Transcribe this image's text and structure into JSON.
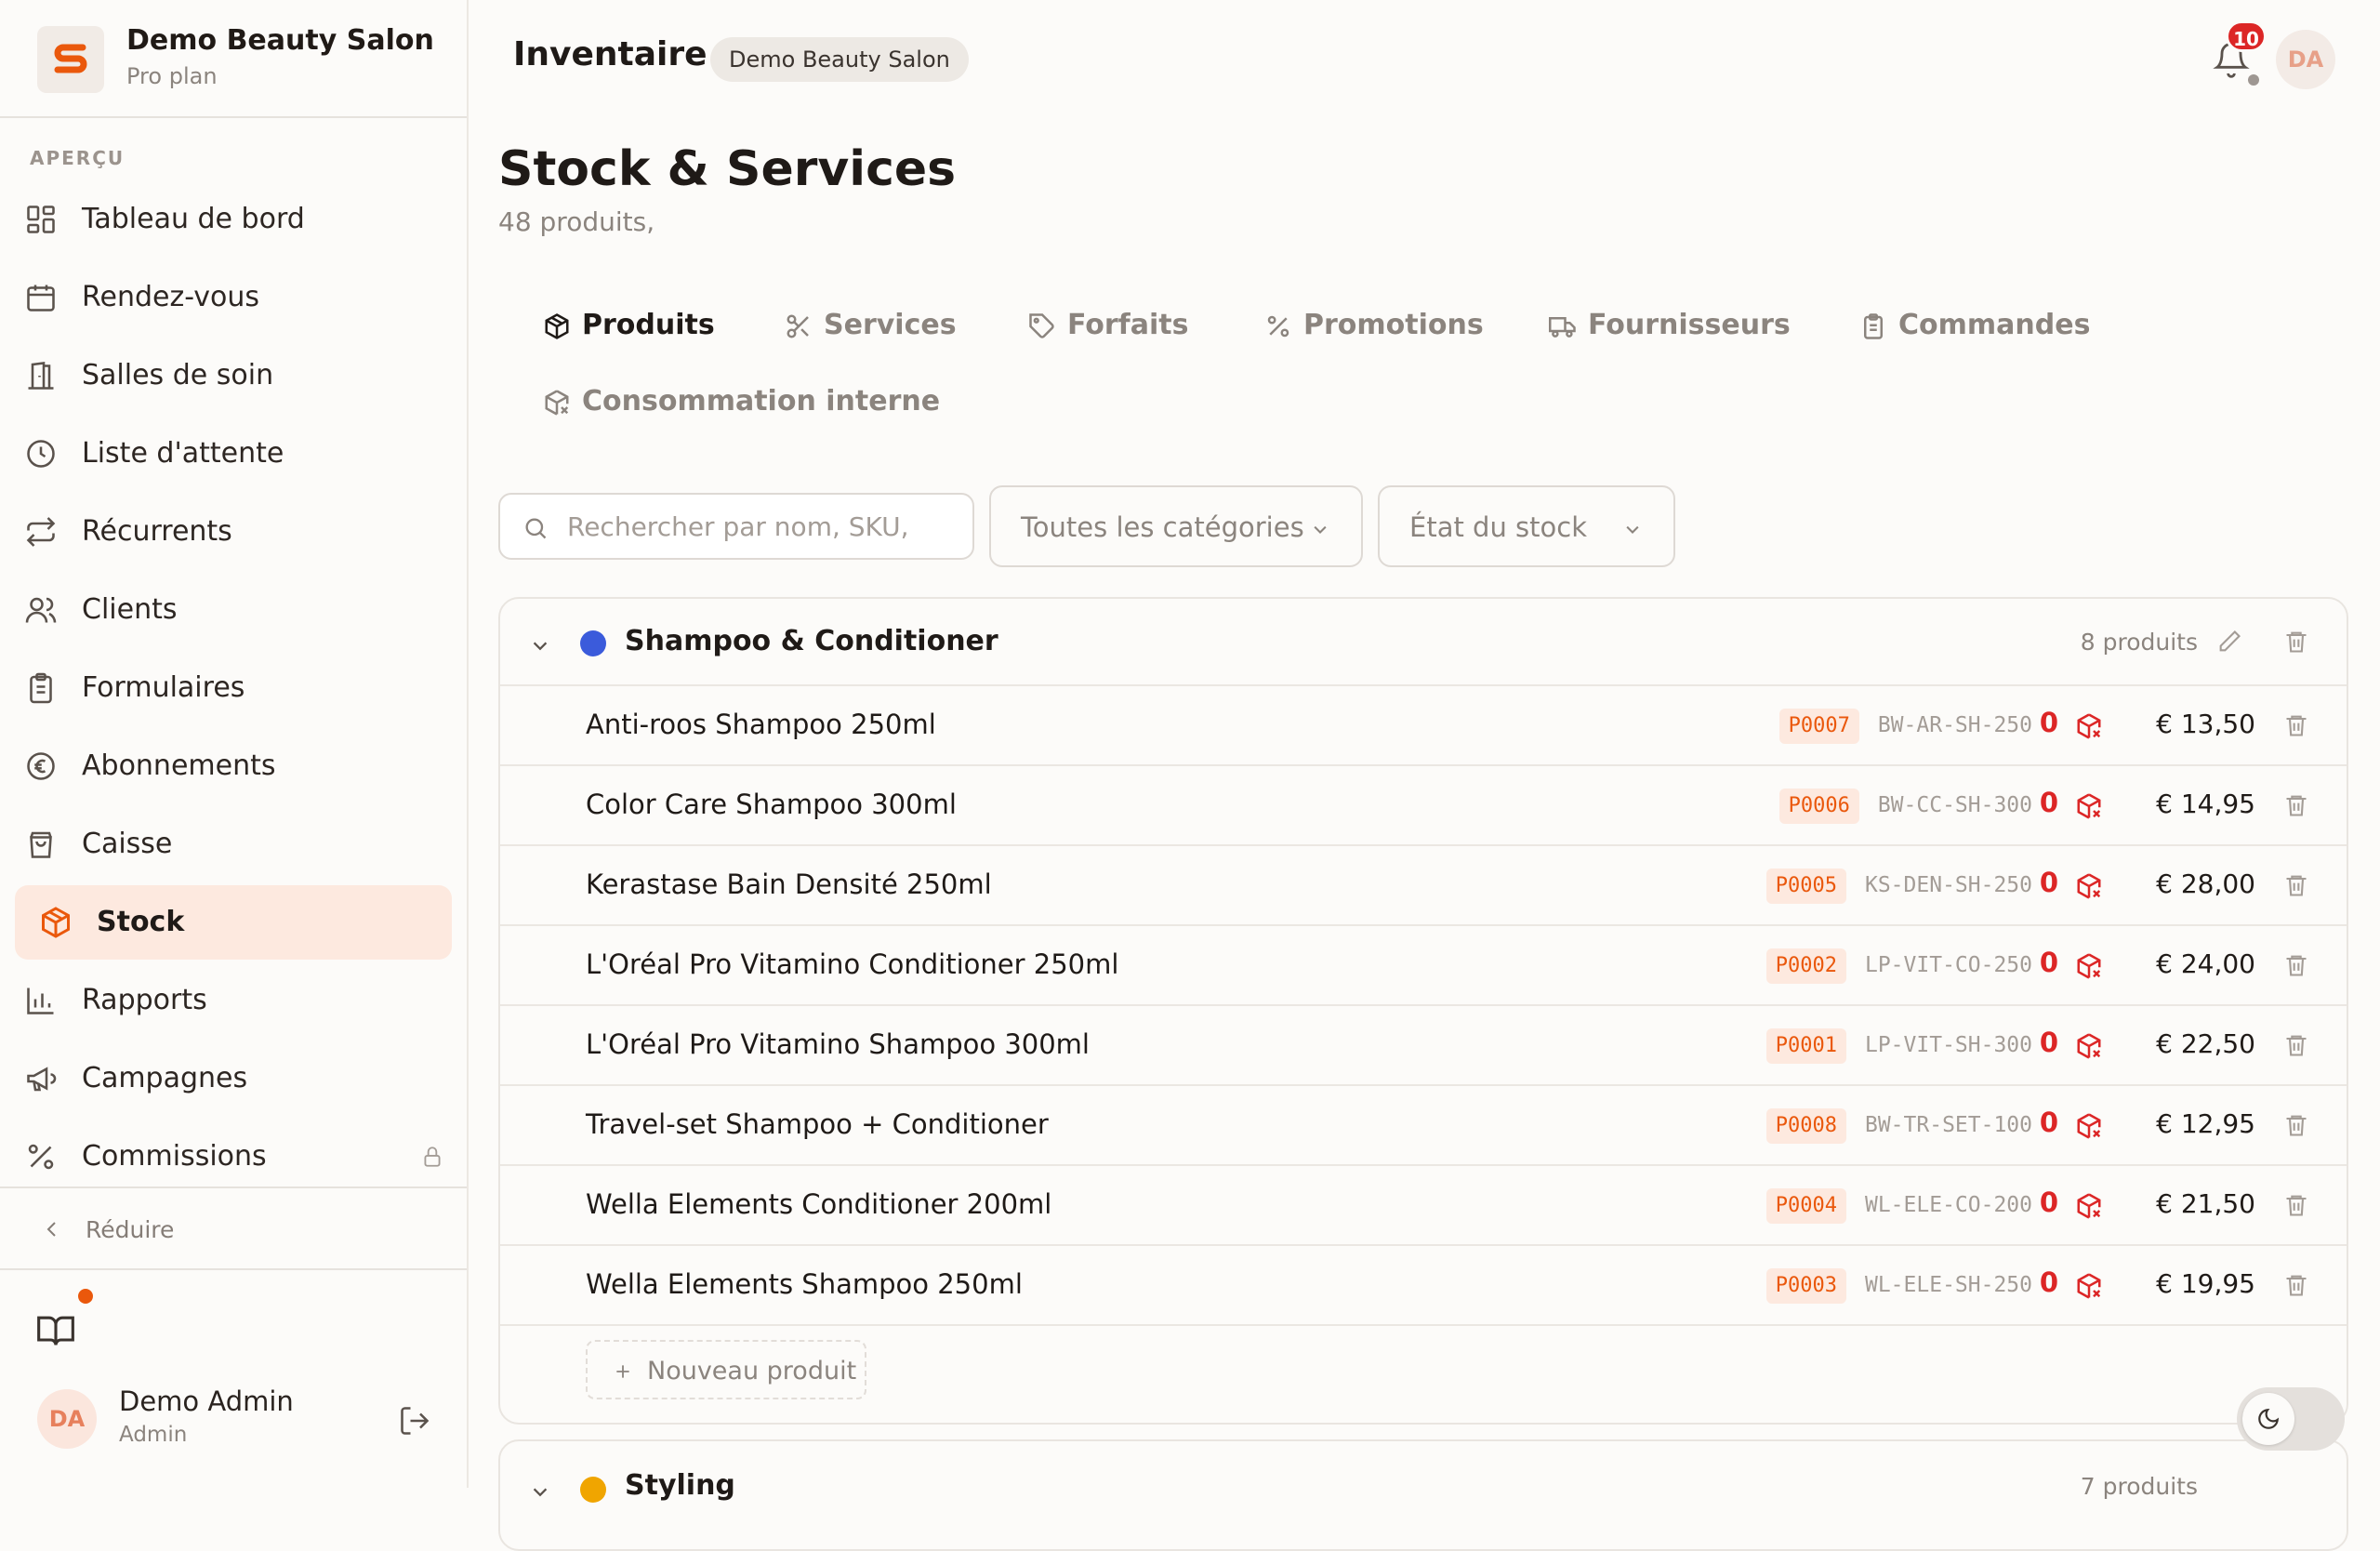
{
  "brand": {
    "name": "Demo Beauty Salon",
    "plan": "Pro plan",
    "logo_letter": "S",
    "accent": "#ea580c"
  },
  "sidebar": {
    "section": "APERÇU",
    "items": [
      {
        "label": "Tableau de bord",
        "icon": "grid-icon"
      },
      {
        "label": "Rendez-vous",
        "icon": "calendar-icon"
      },
      {
        "label": "Salles de soin",
        "icon": "door-icon"
      },
      {
        "label": "Liste d'attente",
        "icon": "clock-icon"
      },
      {
        "label": "Récurrents",
        "icon": "repeat-icon"
      },
      {
        "label": "Clients",
        "icon": "users-icon"
      },
      {
        "label": "Formulaires",
        "icon": "clipboard-icon"
      },
      {
        "label": "Abonnements",
        "icon": "euro-icon"
      },
      {
        "label": "Caisse",
        "icon": "shopping-bag-icon"
      },
      {
        "label": "Stock",
        "icon": "package-icon",
        "active": true
      },
      {
        "label": "Rapports",
        "icon": "bar-chart-icon"
      },
      {
        "label": "Campagnes",
        "icon": "megaphone-icon"
      },
      {
        "label": "Commissions",
        "icon": "percent-icon",
        "locked": true
      }
    ],
    "collapse_label": "Réduire"
  },
  "user": {
    "initials": "DA",
    "name": "Demo Admin",
    "role": "Admin"
  },
  "header": {
    "title": "Inventaire",
    "chip": "Demo Beauty Salon",
    "notifications": "10",
    "avatar": "DA"
  },
  "page": {
    "title": "Stock & Services",
    "subtitle": "48 produits,"
  },
  "tabs": [
    {
      "label": "Produits",
      "icon": "package-icon",
      "active": true
    },
    {
      "label": "Services",
      "icon": "scissors-icon"
    },
    {
      "label": "Forfaits",
      "icon": "tag-icon"
    },
    {
      "label": "Promotions",
      "icon": "percent-icon"
    },
    {
      "label": "Fournisseurs",
      "icon": "truck-icon"
    },
    {
      "label": "Commandes",
      "icon": "clipboard-icon"
    },
    {
      "label": "Consommation interne",
      "icon": "package-x-icon"
    }
  ],
  "filters": {
    "search_placeholder": "Rechercher par nom, SKU,",
    "category": "Toutes les catégories",
    "stock_state": "État du stock"
  },
  "categories": [
    {
      "name": "Shampoo & Conditioner",
      "color": "#3b5bdb",
      "count": "8 produits",
      "products": [
        {
          "name": "Anti-roos Shampoo 250ml",
          "code": "P0007",
          "sku": "BW-AR-SH-250",
          "qty": "0",
          "price": "€ 13,50"
        },
        {
          "name": "Color Care Shampoo 300ml",
          "code": "P0006",
          "sku": "BW-CC-SH-300",
          "qty": "0",
          "price": "€ 14,95"
        },
        {
          "name": "Kerastase Bain Densité 250ml",
          "code": "P0005",
          "sku": "KS-DEN-SH-250",
          "qty": "0",
          "price": "€ 28,00"
        },
        {
          "name": "L'Oréal Pro Vitamino Conditioner 250ml",
          "code": "P0002",
          "sku": "LP-VIT-CO-250",
          "qty": "0",
          "price": "€ 24,00"
        },
        {
          "name": "L'Oréal Pro Vitamino Shampoo 300ml",
          "code": "P0001",
          "sku": "LP-VIT-SH-300",
          "qty": "0",
          "price": "€ 22,50"
        },
        {
          "name": "Travel-set Shampoo + Conditioner",
          "code": "P0008",
          "sku": "BW-TR-SET-100",
          "qty": "0",
          "price": "€ 12,95"
        },
        {
          "name": "Wella Elements Conditioner 200ml",
          "code": "P0004",
          "sku": "WL-ELE-CO-200",
          "qty": "0",
          "price": "€ 21,50"
        },
        {
          "name": "Wella Elements Shampoo 250ml",
          "code": "P0003",
          "sku": "WL-ELE-SH-250",
          "qty": "0",
          "price": "€ 19,95"
        }
      ],
      "new_product_label": "Nouveau produit"
    },
    {
      "name": "Styling",
      "color": "#f0a500",
      "count": "7 produits"
    }
  ]
}
